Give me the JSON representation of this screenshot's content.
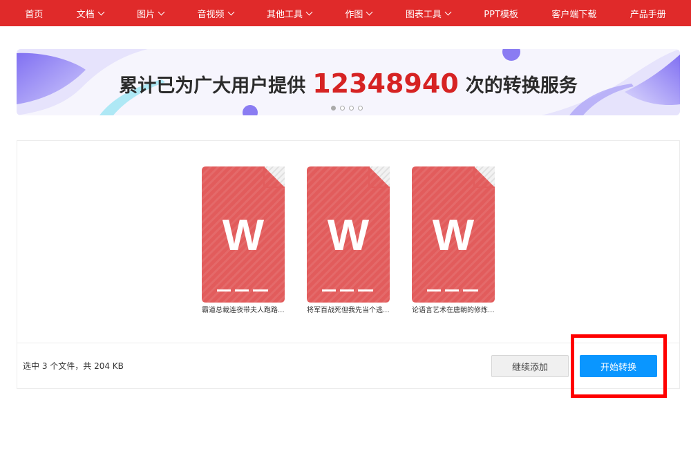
{
  "nav": {
    "items": [
      {
        "label": "首页",
        "dropdown": false
      },
      {
        "label": "文档",
        "dropdown": true
      },
      {
        "label": "图片",
        "dropdown": true
      },
      {
        "label": "音视频",
        "dropdown": true
      },
      {
        "label": "其他工具",
        "dropdown": true
      },
      {
        "label": "作图",
        "dropdown": true
      },
      {
        "label": "图表工具",
        "dropdown": true
      },
      {
        "label": "PPT模板",
        "dropdown": false
      },
      {
        "label": "客户端下载",
        "dropdown": false
      },
      {
        "label": "产品手册",
        "dropdown": false
      }
    ],
    "background": "#e02a2a"
  },
  "banner": {
    "prefix": "累计已为广大用户提供",
    "count": "12348940",
    "suffix": "次的转换服务",
    "slides": 4,
    "active_slide": 1
  },
  "files": [
    {
      "icon_letter": "W",
      "name": "霸道总裁连夜带夫人跑路..."
    },
    {
      "icon_letter": "W",
      "name": "将军百战死但我先当个逃..."
    },
    {
      "icon_letter": "W",
      "name": "论语言艺术在唐朝的修炼..."
    }
  ],
  "footer": {
    "summary": "选中 3 个文件，共 204 KB",
    "add_label": "继续添加",
    "start_label": "开始转换"
  },
  "colors": {
    "accent": "#e02a2a",
    "file_icon": "#e25c5c",
    "primary_button": "#0a96ff",
    "highlight_box": "#ff0000"
  }
}
